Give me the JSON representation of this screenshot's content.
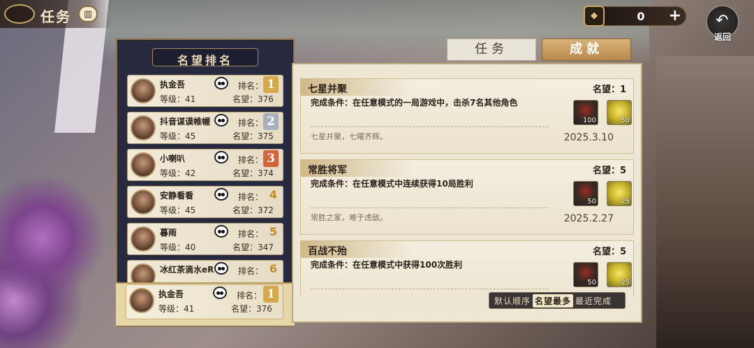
{
  "header": {
    "title": "任务",
    "currency_value": "0",
    "back_label": "返回"
  },
  "tabs": [
    {
      "label": "任务",
      "active": false
    },
    {
      "label": "成就",
      "active": true
    }
  ],
  "ranking": {
    "title": "名望排名",
    "rank_label": "排名：",
    "level_label_prefix": "等级：",
    "fame_label_prefix": "名望：",
    "rows": [
      {
        "name": "执金吾",
        "level": "等级：41",
        "rank": "1",
        "fame": "名望：376",
        "badge": "gold"
      },
      {
        "name": "抖音谋谟帷幄",
        "level": "等级：45",
        "rank": "2",
        "fame": "名望：375",
        "badge": "silver"
      },
      {
        "name": "小喇叭",
        "level": "等级：42",
        "rank": "3",
        "fame": "名望：374",
        "badge": "bronze"
      },
      {
        "name": "安静看看",
        "level": "等级：45",
        "rank": "4",
        "fame": "名望：372",
        "badge": "plain"
      },
      {
        "name": "暮雨",
        "level": "等级：40",
        "rank": "5",
        "fame": "名望：347",
        "badge": "plain"
      },
      {
        "name": "冰红茶滴水eR",
        "level": "",
        "rank": "6",
        "fame": "",
        "badge": "plain"
      }
    ],
    "self": {
      "name": "执金吾",
      "level": "等级：41",
      "rank": "1",
      "fame": "名望：376",
      "badge": "gold"
    }
  },
  "achievements": [
    {
      "title": "七星并聚",
      "fame": "名望：1",
      "condition": "完成条件：在任意模式的一局游戏中，击杀7名其他角色",
      "flavor": "七星并聚，七曜齐辉。",
      "date": "2025.3.10",
      "rewards": [
        {
          "icon": "equipment-icon",
          "count": "100"
        },
        {
          "icon": "gold-ingot-icon",
          "count": "50"
        }
      ]
    },
    {
      "title": "常胜将军",
      "fame": "名望：5",
      "condition": "完成条件：在任意模式中连续获得10局胜利",
      "flavor": "常胜之家，难于虑敌。",
      "date": "2025.2.27",
      "rewards": [
        {
          "icon": "equipment-icon",
          "count": "50"
        },
        {
          "icon": "gold-ingot-icon",
          "count": "25"
        }
      ]
    },
    {
      "title": "百战不殆",
      "fame": "名望：5",
      "condition": "完成条件：在任意模式中获得100次胜利",
      "flavor": "",
      "date": "",
      "rewards": [
        {
          "icon": "equipment-icon",
          "count": "50"
        },
        {
          "icon": "gold-ingot-icon",
          "count": "25"
        }
      ]
    }
  ],
  "sort": {
    "options": [
      "默认顺序",
      "名望最多",
      "最近完成"
    ],
    "active": "名望最多"
  },
  "colors": {
    "gold_badge": "#d6a84a",
    "silver_badge": "#a9b0bd",
    "bronze_badge": "#d3643a",
    "panel_dark": "#272a3f",
    "tab_active": "#c39553"
  }
}
